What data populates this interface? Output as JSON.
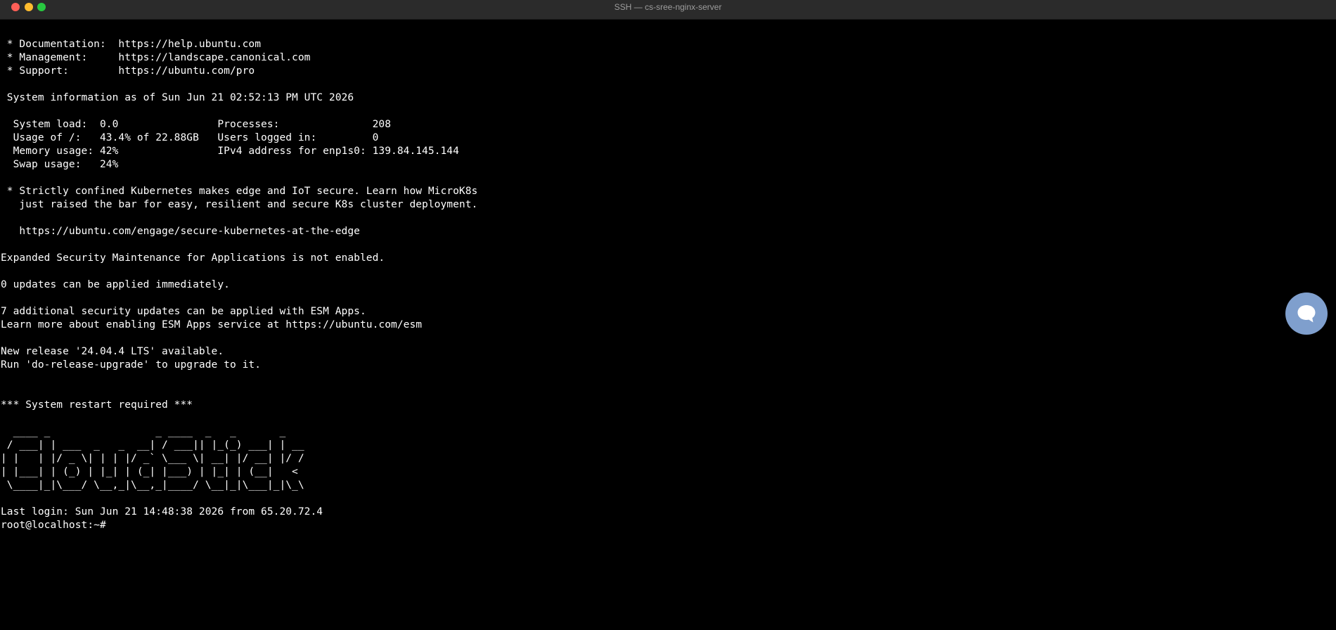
{
  "window": {
    "title": "SSH — cs-sree-nginx-server"
  },
  "colors": {
    "background": "#000000",
    "text": "#ffffff",
    "titlebar": "#2b2b2b",
    "close": "#fe5f57",
    "minimize": "#febc2e",
    "maximize": "#28c840",
    "chat_button": "#7f9fcd"
  },
  "terminal": {
    "lines": [
      " * Documentation:  https://help.ubuntu.com",
      " * Management:     https://landscape.canonical.com",
      " * Support:        https://ubuntu.com/pro",
      "",
      " System information as of Sun Jun 21 02:52:13 PM UTC 2026",
      "",
      "  System load:  0.0                Processes:               208",
      "  Usage of /:   43.4% of 22.88GB   Users logged in:         0",
      "  Memory usage: 42%                IPv4 address for enp1s0: 139.84.145.144",
      "  Swap usage:   24%",
      "",
      " * Strictly confined Kubernetes makes edge and IoT secure. Learn how MicroK8s",
      "   just raised the bar for easy, resilient and secure K8s cluster deployment.",
      "",
      "   https://ubuntu.com/engage/secure-kubernetes-at-the-edge",
      "",
      "Expanded Security Maintenance for Applications is not enabled.",
      "",
      "0 updates can be applied immediately.",
      "",
      "7 additional security updates can be applied with ESM Apps.",
      "Learn more about enabling ESM Apps service at https://ubuntu.com/esm",
      "",
      "New release '24.04.4 LTS' available.",
      "Run 'do-release-upgrade' to upgrade to it.",
      "",
      "",
      "*** System restart required ***",
      "",
      "  ____ _                 _ ____  _   _       _",
      " / ___| | ___  _   _  __| / ___|| |_(_) ___| | __",
      "| |   | |/ _ \\| | | |/ _` \\___ \\| __| |/ __| |/ /",
      "| |___| | (_) | |_| | (_| |___) | |_| | (__|   <",
      " \\____|_|\\___/ \\__,_|\\__,_|____/ \\__|_|\\___|_|\\_\\",
      "",
      "Last login: Sun Jun 21 14:48:38 2026 from 65.20.72.4",
      "root@localhost:~#"
    ]
  },
  "chat_button": {
    "icon": "chat-bubble-icon"
  }
}
